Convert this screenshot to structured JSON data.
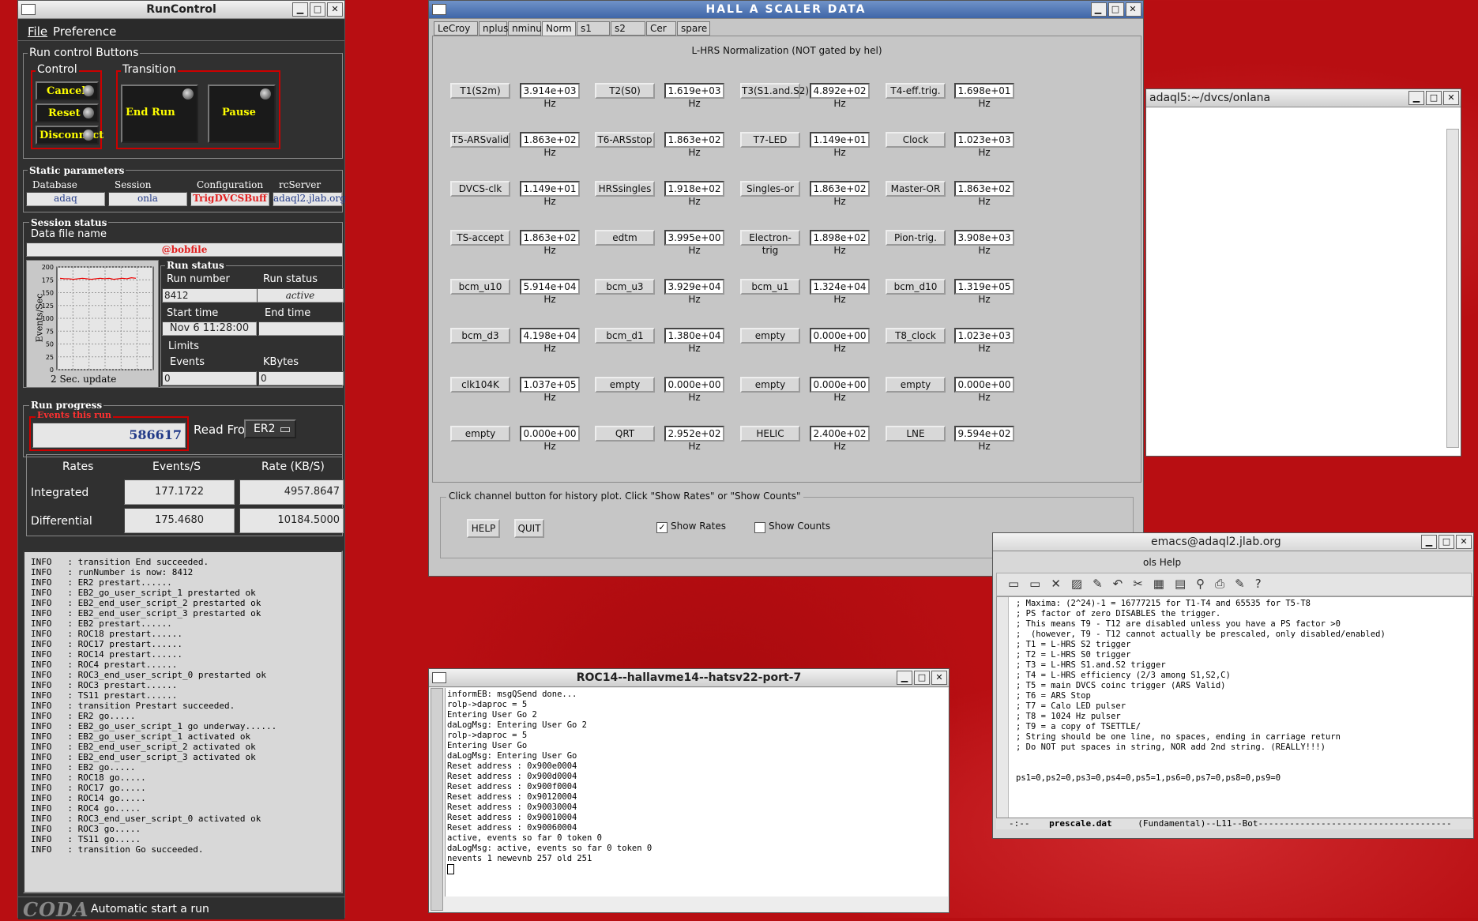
{
  "runcontrol": {
    "title": "RunControl",
    "menu": [
      "File",
      "Preference"
    ],
    "run_control_buttons_label": "Run control Buttons",
    "control_label": "Control",
    "transition_label": "Transition",
    "control_buttons": [
      "Cancel",
      "Reset",
      "Disconnect"
    ],
    "transition_buttons": [
      "End Run",
      "Pause"
    ],
    "static_params_label": "Static parameters",
    "params": [
      {
        "label": "Database",
        "value": "adaq"
      },
      {
        "label": "Session",
        "value": "onla"
      },
      {
        "label": "Configuration",
        "value": "TrigDVCSBuff"
      },
      {
        "label": "rcServer",
        "value": "adaql2.jlab.org"
      }
    ],
    "session_status_label": "Session status",
    "data_file_label": "Data file name",
    "data_file": "@bobfile",
    "graph": {
      "ylabel": "Events/Sec",
      "yticks": [
        "200",
        "175",
        "150",
        "125",
        "100",
        "75",
        "50",
        "25",
        "0"
      ],
      "update": "2 Sec. update",
      "trace": [
        178,
        177,
        177,
        176,
        177,
        178,
        177,
        176,
        177,
        178,
        177,
        178,
        176,
        177,
        178,
        177,
        179,
        178
      ]
    },
    "run_status_label": "Run status",
    "run_number_label": "Run number",
    "run_number": "8412",
    "run_state_label": "Run status",
    "run_state": "active",
    "start_time_label": "Start time",
    "start_time": "Nov 6 11:28:00",
    "end_time_label": "End time",
    "end_time": "",
    "limits_label": "Limits",
    "events_label": "Events",
    "events_limit": "0",
    "kbytes_label": "KBytes",
    "kbytes_limit": "0",
    "run_progress_label": "Run progress",
    "events_this_run_label": "Events this run",
    "events_this_run": "586617",
    "read_from_label": "Read From:",
    "read_from": "ER2",
    "rates": {
      "col_labels": [
        "Rates",
        "Events/S",
        "Rate (KB/S)"
      ],
      "rows": [
        {
          "label": "Integrated",
          "events": "177.1722",
          "kb": "4957.8647"
        },
        {
          "label": "Differential",
          "events": "175.4680",
          "kb": "10184.5000"
        }
      ]
    },
    "log": [
      "INFO   : transition End succeeded.",
      "INFO   : runNumber is now: 8412",
      "INFO   : ER2 prestart......",
      "INFO   : EB2_go_user_script_1 prestarted ok",
      "INFO   : EB2_end_user_script_2 prestarted ok",
      "INFO   : EB2_end_user_script_3 prestarted ok",
      "INFO   : EB2 prestart......",
      "INFO   : ROC18 prestart......",
      "INFO   : ROC17 prestart......",
      "INFO   : ROC14 prestart......",
      "INFO   : ROC4 prestart......",
      "INFO   : ROC3_end_user_script_0 prestarted ok",
      "INFO   : ROC3 prestart......",
      "INFO   : TS11 prestart......",
      "INFO   : transition Prestart succeeded.",
      "INFO   : ER2 go.....",
      "INFO   : EB2_go_user_script_1 go underway......",
      "INFO   : EB2_go_user_script_1 activated ok",
      "INFO   : EB2_end_user_script_2 activated ok",
      "INFO   : EB2_end_user_script_3 activated ok",
      "INFO   : EB2 go.....",
      "INFO   : ROC18 go.....",
      "INFO   : ROC17 go.....",
      "INFO   : ROC14 go.....",
      "INFO   : ROC4 go.....",
      "INFO   : ROC3_end_user_script_0 activated ok",
      "INFO   : ROC3 go.....",
      "INFO   : TS11 go.....",
      "INFO   : transition Go succeeded."
    ],
    "status_logo": "CODA",
    "status_text": "Automatic start a run"
  },
  "scaler": {
    "title": "HALL  A  SCALER  DATA",
    "tabs": [
      "LeCroy",
      "nplus",
      "nminus",
      "Norm",
      "s1",
      "s2",
      "Cer",
      "spare"
    ],
    "selected_tab": "Norm",
    "heading": "L-HRS Normalization (NOT gated by hel)",
    "rows": [
      [
        [
          "T1(S2m)",
          "3.914e+03 Hz"
        ],
        [
          "T2(S0)",
          "1.619e+03 Hz"
        ],
        [
          "T3(S1.and.S2)",
          "4.892e+02 Hz"
        ],
        [
          "T4-eff.trig.",
          "1.698e+01 Hz"
        ]
      ],
      [
        [
          "T5-ARSvalid",
          "1.863e+02 Hz"
        ],
        [
          "T6-ARSstop",
          "1.863e+02 Hz"
        ],
        [
          "T7-LED",
          "1.149e+01 Hz"
        ],
        [
          "Clock",
          "1.023e+03 Hz"
        ]
      ],
      [
        [
          "DVCS-clk",
          "1.149e+01 Hz"
        ],
        [
          "HRSsingles",
          "1.918e+02 Hz"
        ],
        [
          "Singles-or",
          "1.863e+02 Hz"
        ],
        [
          "Master-OR",
          "1.863e+02 Hz"
        ]
      ],
      [
        [
          "TS-accept",
          "1.863e+02 Hz"
        ],
        [
          "edtm",
          "3.995e+00 Hz"
        ],
        [
          "Electron-trig",
          "1.898e+02 Hz"
        ],
        [
          "Pion-trig.",
          "3.908e+03 Hz"
        ]
      ],
      [
        [
          "bcm_u10",
          "5.914e+04 Hz"
        ],
        [
          "bcm_u3",
          "3.929e+04 Hz"
        ],
        [
          "bcm_u1",
          "1.324e+04 Hz"
        ],
        [
          "bcm_d10",
          "1.319e+05 Hz"
        ]
      ],
      [
        [
          "bcm_d3",
          "4.198e+04 Hz"
        ],
        [
          "bcm_d1",
          "1.380e+04 Hz"
        ],
        [
          "empty",
          "0.000e+00 Hz"
        ],
        [
          "T8_clock",
          "1.023e+03 Hz"
        ]
      ],
      [
        [
          "clk104K",
          "1.037e+05 Hz"
        ],
        [
          "empty",
          "0.000e+00 Hz"
        ],
        [
          "empty",
          "0.000e+00 Hz"
        ],
        [
          "empty",
          "0.000e+00 Hz"
        ]
      ],
      [
        [
          "empty",
          "0.000e+00 Hz"
        ],
        [
          "QRT",
          "2.952e+02 Hz"
        ],
        [
          "HELIC",
          "2.400e+02 Hz"
        ],
        [
          "LNE",
          "9.594e+02 Hz"
        ]
      ]
    ],
    "footer_label": "Click channel button for history plot.  Click \"Show Rates\" or \"Show Counts\"",
    "help": "HELP",
    "quit": "QUIT",
    "show_rates": "Show Rates",
    "show_counts": "Show Counts"
  },
  "onlana": {
    "title": "adaql5:~/dvcs/onlana"
  },
  "roc": {
    "title": "ROC14--hallavme14--hatsv22-port-7",
    "lines": [
      "informEB: msgQSend done...",
      "rolp->daproc = 5",
      "Entering User Go 2",
      "daLogMsg: Entering User Go 2",
      "rolp->daproc = 5",
      "Entering User Go",
      "daLogMsg: Entering User Go",
      "Reset address : 0x900e0004",
      "Reset address : 0x900d0004",
      "Reset address : 0x900f0004",
      "Reset address : 0x90120004",
      "Reset address : 0x90030004",
      "Reset address : 0x90010004",
      "Reset address : 0x90060004",
      "active, events so far 0 token 0",
      "daLogMsg: active, events so far 0 token 0",
      "nevents 1 newevnb 257 old 251"
    ]
  },
  "emacs": {
    "title": "emacs@adaql2.jlab.org",
    "menu_tail": "ols  Help",
    "lines": [
      "; Maxima: (2^24)-1 = 16777215 for T1-T4 and 65535 for T5-T8",
      "; PS factor of zero DISABLES the trigger.",
      "; This means T9 - T12 are disabled unless you have a PS factor >0",
      ";  (however, T9 - T12 cannot actually be prescaled, only disabled/enabled)",
      "; T1 = L-HRS S2 trigger",
      "; T2 = L-HRS S0 trigger",
      "; T3 = L-HRS S1.and.S2 trigger",
      "; T4 = L-HRS efficiency (2/3 among S1,S2,C)",
      "; T5 = main DVCS coinc trigger (ARS Valid)",
      "; T6 = ARS Stop",
      "; T7 = Calo LED pulser",
      "; T8 = 1024 Hz pulser",
      "; T9 = a copy of TSETTLE/",
      "; String should be one line, no spaces, ending in carriage return",
      "; Do NOT put spaces in string, NOR add 2nd string. (REALLY!!!)",
      "",
      "",
      "ps1=0,ps2=0,ps3=0,ps4=0,ps5=1,ps6=0,ps7=0,ps8=0,ps9=0"
    ],
    "modeline_prefix": "-:--",
    "modeline_file": "prescale.dat",
    "modeline_rest": "(Fundamental)--L11--Bot-------------------------------------"
  },
  "colors": {
    "desktop": "#b80e12",
    "accent_red": "#ff2020",
    "yellow_text": "#ffff00",
    "dark_panel": "#303030"
  }
}
